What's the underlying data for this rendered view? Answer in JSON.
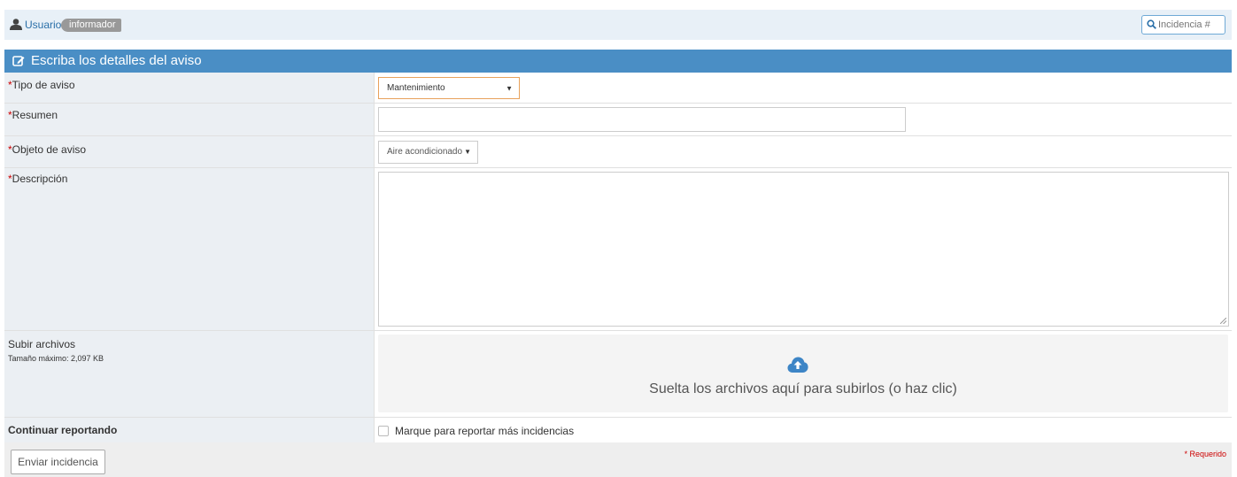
{
  "topbar": {
    "user_label": "Usuario",
    "role_badge": "informador",
    "search_placeholder": "Incidencia #"
  },
  "panel": {
    "title": "Escriba los detalles del aviso"
  },
  "form": {
    "required_mark": "*",
    "tipo": {
      "label": "Tipo de aviso",
      "value": "Mantenimiento"
    },
    "resumen": {
      "label": "Resumen",
      "value": ""
    },
    "objeto": {
      "label": "Objeto de aviso",
      "value": "Aire acondicionado"
    },
    "descripcion": {
      "label": "Descripción",
      "value": ""
    },
    "archivos": {
      "label": "Subir archivos",
      "size_note": "Tamaño máximo: 2,097 KB",
      "drop_text": "Suelta los archivos aquí para subirlos (o haz clic)"
    },
    "continuar": {
      "label": "Continuar reportando",
      "checkbox_label": "Marque para reportar más incidencias",
      "checked": false
    }
  },
  "footer": {
    "submit_label": "Enviar incidencia",
    "required_note": "* Requerido"
  },
  "colors": {
    "header_blue": "#4a8ec5",
    "label_bg": "#ebeff3",
    "required_red": "#cc0000",
    "focus_orange": "#e8a25c"
  }
}
